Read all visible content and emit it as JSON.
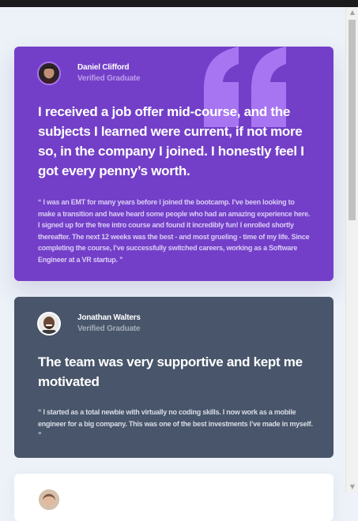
{
  "testimonials": [
    {
      "name": "Daniel Clifford",
      "role": "Verified Graduate",
      "headline": "I received a job offer mid-course, and the subjects I learned were current, if not more so, in the company I joined. I honestly feel I got every penny’s worth.",
      "quote": "“ I was an EMT for many years before I joined the bootcamp. I’ve been looking to make a transition and have heard some people who had an amazing experience here. I signed up for the free intro course and found it incredibly fun! I enrolled shortly thereafter. The next 12 weeks was the best - and most grueling - time of my life. Since completing the course, I’ve successfully switched careers, working as a Software Engineer at a VR startup. ”",
      "background": "#733fc8"
    },
    {
      "name": "Jonathan Walters",
      "role": "Verified Graduate",
      "headline": "The team was very supportive and kept me motivated",
      "quote": "“ I started as a total newbie with virtually no coding skills. I now work as a mobile engineer for a big company. This was one of the best investments I’ve made in myself. ”",
      "background": "#48556a"
    },
    {
      "background": "#ffffff"
    }
  ],
  "icons": {
    "quote": "quote-mark-icon",
    "scroll_up": "scroll-up-arrow-icon",
    "scroll_down": "scroll-down-arrow-icon"
  },
  "colors": {
    "page_background": "#ecf2f8",
    "quote_mark": "#a775f1",
    "top_bar": "#1b1b1b"
  }
}
